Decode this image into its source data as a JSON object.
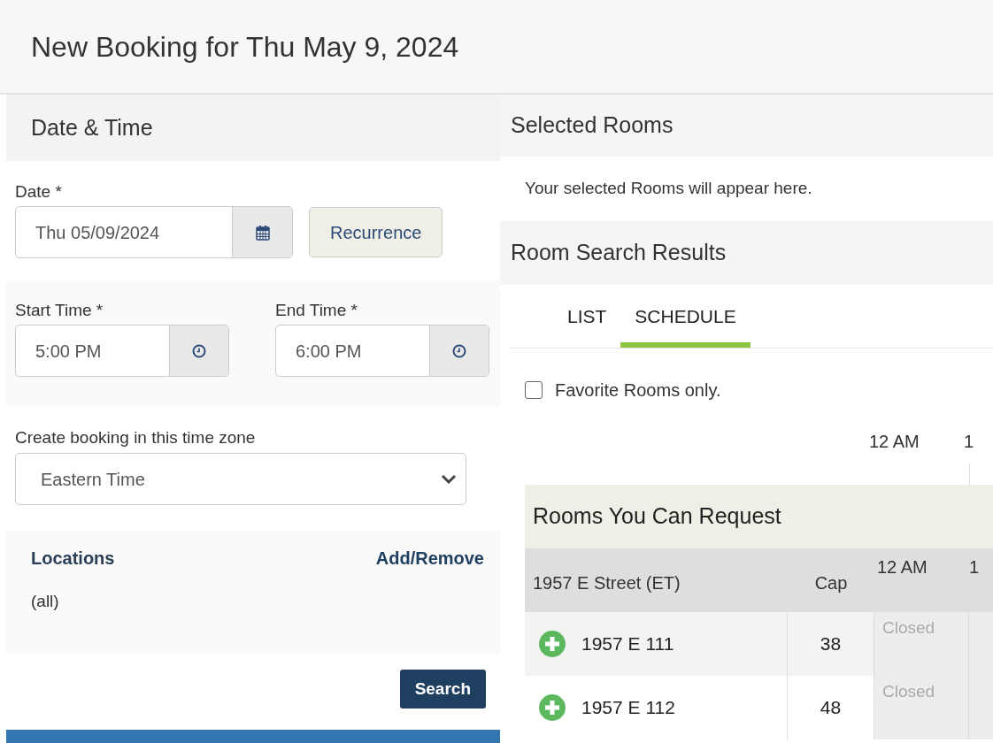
{
  "title": "New Booking for Thu May 9, 2024",
  "date_time": {
    "heading": "Date & Time",
    "date_label": "Date *",
    "date_value": "Thu 05/09/2024",
    "recurrence_button": "Recurrence",
    "start_label": "Start Time *",
    "start_value": "5:00 PM",
    "end_label": "End Time *",
    "end_value": "6:00 PM",
    "timezone_label": "Create booking in this time zone",
    "timezone_value": "Eastern Time",
    "locations_label": "Locations",
    "locations_link": "Add/Remove",
    "locations_value": "(all)",
    "search_button": "Search"
  },
  "selected_rooms": {
    "heading": "Selected Rooms",
    "empty_text": "Your selected Rooms will appear here."
  },
  "results": {
    "heading": "Room Search Results",
    "tabs": [
      {
        "label": "LIST",
        "selected": false
      },
      {
        "label": "SCHEDULE",
        "selected": true
      }
    ],
    "favorites": {
      "label": "Favorite Rooms only.",
      "checked": false
    },
    "timeline": [
      "12 AM",
      "1"
    ],
    "group_title": "Rooms You Can Request",
    "columns": [
      "1957 E Street (ET)",
      "Cap"
    ],
    "time_columns": [
      "12 AM",
      "1"
    ],
    "rows": [
      {
        "name": "1957 E 111",
        "cap": "38",
        "status": "Closed"
      },
      {
        "name": "1957 E 112",
        "cap": "48",
        "status": "Closed"
      }
    ]
  }
}
